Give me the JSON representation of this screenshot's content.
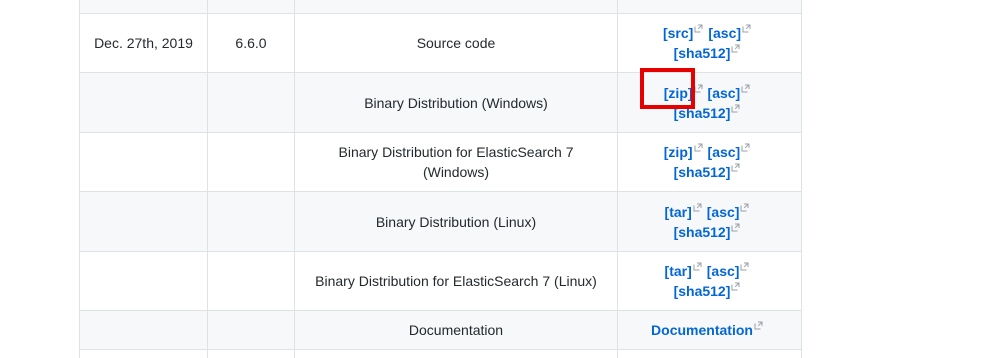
{
  "rows": [
    {
      "date": "",
      "version": "",
      "description": "",
      "links": []
    },
    {
      "date": "Dec. 27th, 2019",
      "version": "6.6.0",
      "description": "Source code",
      "links": [
        "[src]",
        "[asc]",
        "[sha512]"
      ]
    },
    {
      "date": "",
      "version": "",
      "description": "Binary Distribution (Windows)",
      "links": [
        "[zip]",
        "[asc]",
        "[sha512]"
      ]
    },
    {
      "date": "",
      "version": "",
      "description": "Binary Distribution for ElasticSearch 7 (Windows)",
      "links": [
        "[zip]",
        "[asc]",
        "[sha512]"
      ]
    },
    {
      "date": "",
      "version": "",
      "description": "Binary Distribution (Linux)",
      "links": [
        "[tar]",
        "[asc]",
        "[sha512]"
      ]
    },
    {
      "date": "",
      "version": "",
      "description": "Binary Distribution for ElasticSearch 7 (Linux)",
      "links": [
        "[tar]",
        "[asc]",
        "[sha512]"
      ]
    },
    {
      "date": "",
      "version": "",
      "description": "Documentation",
      "links": [
        "Documentation"
      ]
    }
  ],
  "icons": {
    "external_link": "external-link-icon"
  },
  "colors": {
    "link": "#0366d6",
    "highlight": "#e60000",
    "stripe": "#f6f8fa",
    "border": "#dfe2e5"
  }
}
